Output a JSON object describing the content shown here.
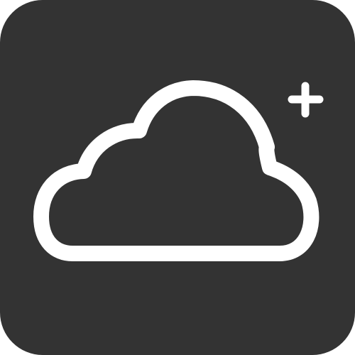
{
  "app_icon": {
    "icon_name": "cloud-plus-icon",
    "background_color": "#333333",
    "foreground_color": "#ffffff"
  }
}
